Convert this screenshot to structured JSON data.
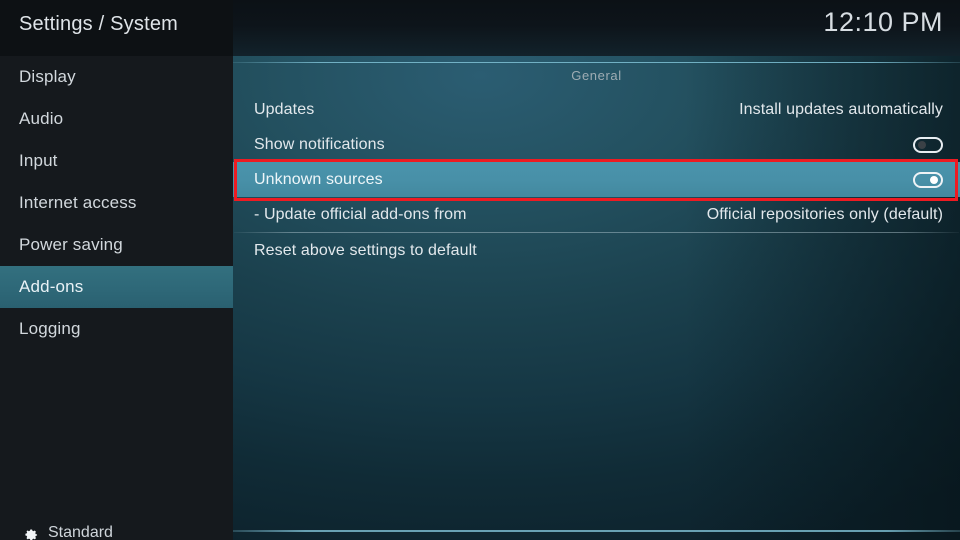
{
  "header": {
    "breadcrumb": "Settings / System",
    "clock": "12:10 PM"
  },
  "sidebar": {
    "items": [
      {
        "label": "Display",
        "selected": false
      },
      {
        "label": "Audio",
        "selected": false
      },
      {
        "label": "Input",
        "selected": false
      },
      {
        "label": "Internet access",
        "selected": false
      },
      {
        "label": "Power saving",
        "selected": false
      },
      {
        "label": "Add-ons",
        "selected": true
      },
      {
        "label": "Logging",
        "selected": false
      }
    ],
    "profile": {
      "icon": "gear-icon",
      "label": "Standard"
    }
  },
  "main": {
    "group_title": "General",
    "rows": [
      {
        "label": "Updates",
        "value": "Install updates automatically",
        "control": "text",
        "focused": false
      },
      {
        "label": "Show notifications",
        "control": "toggle",
        "toggle_state": "off",
        "focused": false
      },
      {
        "label": "Unknown sources",
        "control": "toggle",
        "toggle_state": "on",
        "focused": true
      },
      {
        "label": "- Update official add-ons from",
        "value": "Official repositories only (default)",
        "control": "text",
        "focused": false
      },
      {
        "label": "Reset above settings to default",
        "control": "none",
        "focused": false
      }
    ]
  },
  "annotation": {
    "color": "#ee1b22",
    "target": "Unknown sources"
  }
}
